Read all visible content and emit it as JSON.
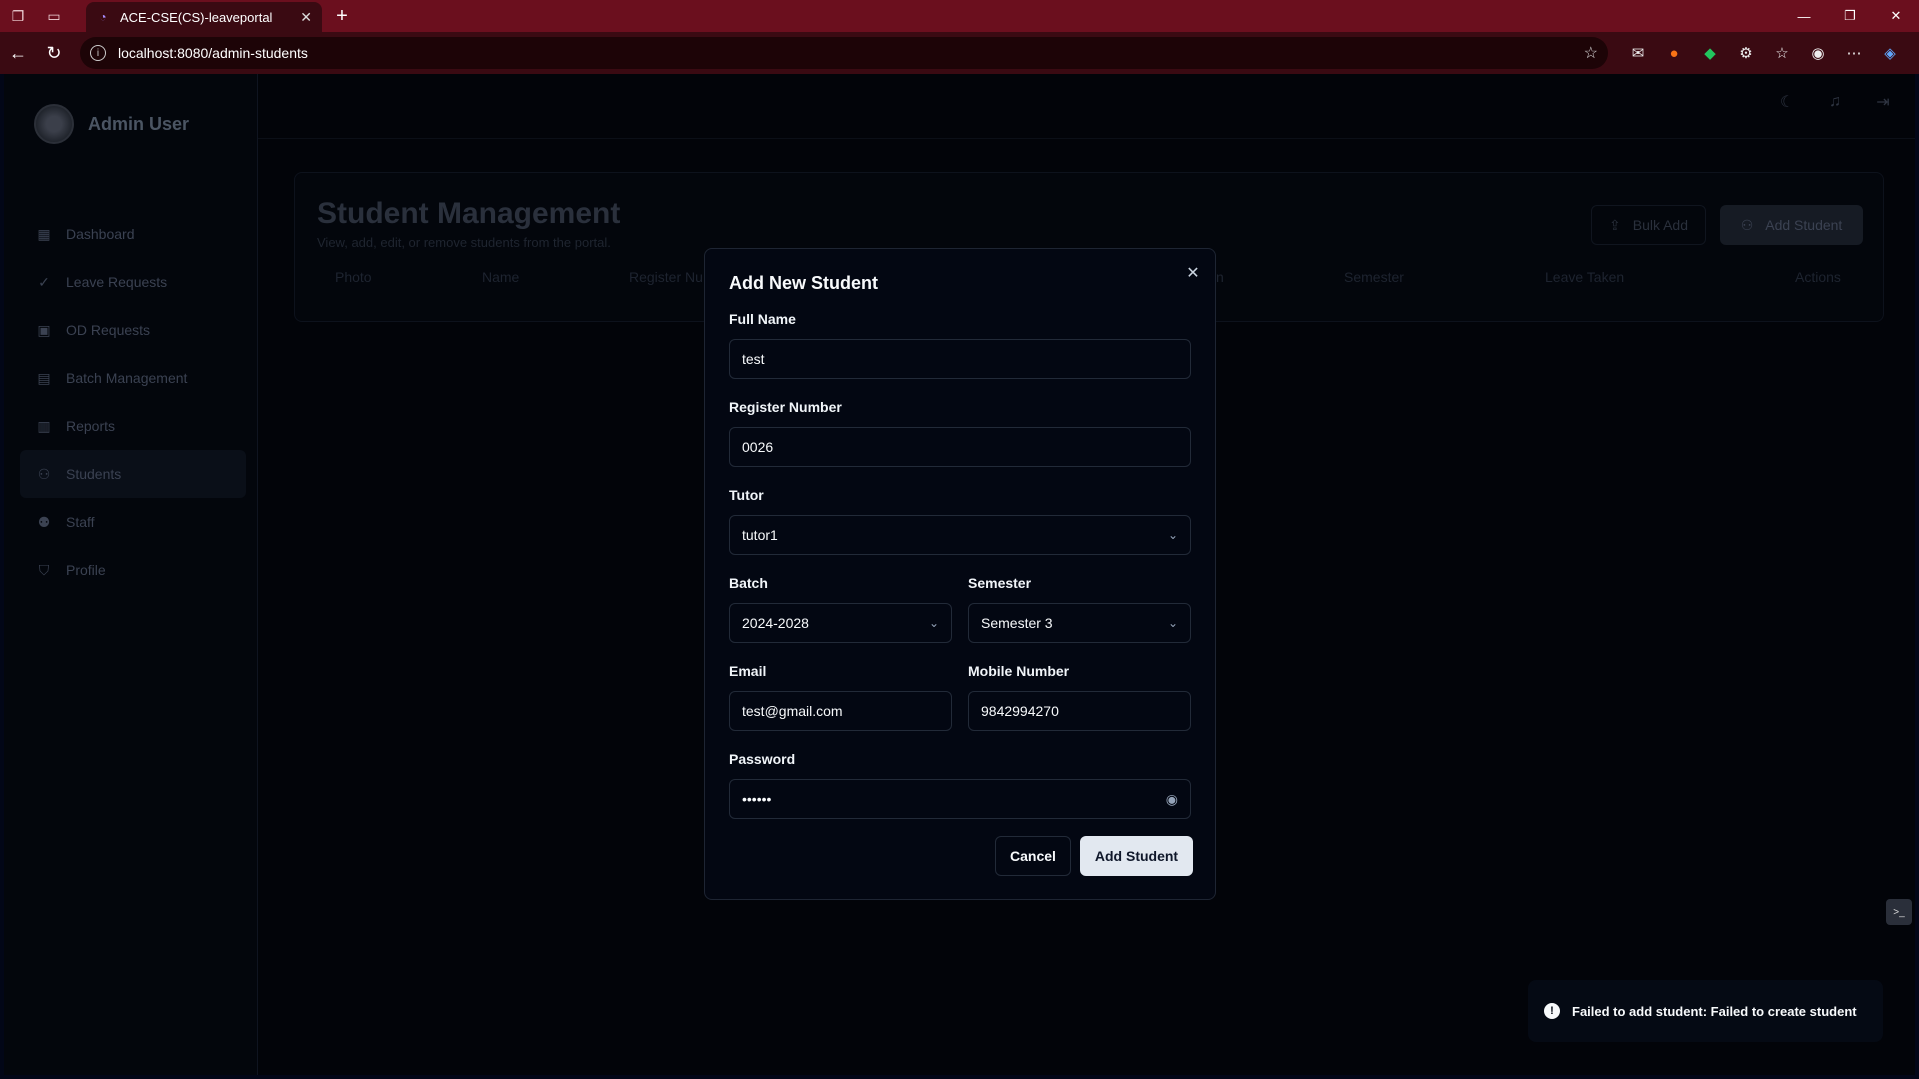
{
  "browser": {
    "tab_title": "ACE-CSE(CS)-leaveportal",
    "url": "localhost:8080/admin-students"
  },
  "sidebar": {
    "user_name": "Admin User",
    "items": [
      {
        "label": "Dashboard",
        "icon": "grid-icon"
      },
      {
        "label": "Leave Requests",
        "icon": "check-circle-icon"
      },
      {
        "label": "OD Requests",
        "icon": "briefcase-icon"
      },
      {
        "label": "Batch Management",
        "icon": "calendar-icon"
      },
      {
        "label": "Reports",
        "icon": "clipboard-icon"
      },
      {
        "label": "Students",
        "icon": "users-icon"
      },
      {
        "label": "Staff",
        "icon": "user-cog-icon"
      },
      {
        "label": "Profile",
        "icon": "shield-icon"
      }
    ]
  },
  "page": {
    "title": "Student Management",
    "subtitle": "View, add, edit, or remove students from the portal.",
    "bulk_add_label": "Bulk Add",
    "add_student_label": "Add Student",
    "columns": [
      "Photo",
      "Name",
      "Register Nu",
      "n",
      "Semester",
      "Leave Taken",
      "Actions"
    ]
  },
  "modal": {
    "title": "Add New Student",
    "full_name_label": "Full Name",
    "full_name_value": "test",
    "register_label": "Register Number",
    "register_value": "0026",
    "tutor_label": "Tutor",
    "tutor_value": "tutor1",
    "batch_label": "Batch",
    "batch_value": "2024-2028",
    "semester_label": "Semester",
    "semester_value": "Semester 3",
    "email_label": "Email",
    "email_value": "test@gmail.com",
    "mobile_label": "Mobile Number",
    "mobile_value": "9842994270",
    "password_label": "Password",
    "password_value": "••••••",
    "cancel_label": "Cancel",
    "submit_label": "Add Student"
  },
  "toast": {
    "message": "Failed to add student: Failed to create student"
  }
}
